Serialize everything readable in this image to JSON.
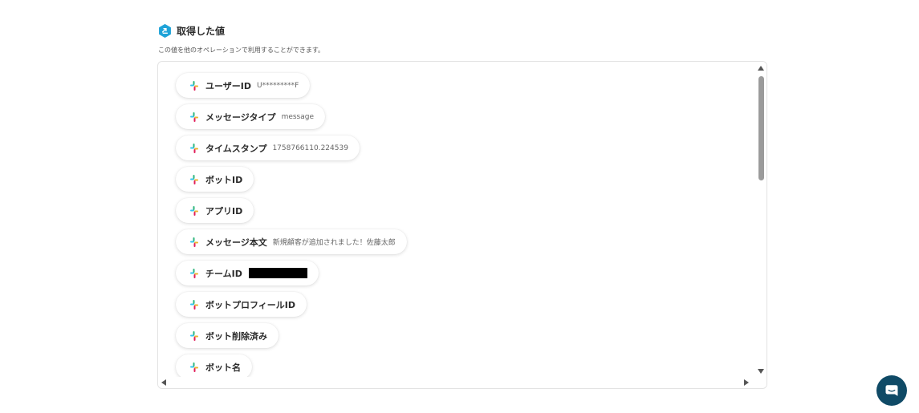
{
  "section": {
    "title": "取得した値",
    "description": "この値を他のオペレーションで利用することができます。"
  },
  "items": [
    {
      "label": "ユーザーID",
      "value": "U*********F"
    },
    {
      "label": "メッセージタイプ",
      "value": "message"
    },
    {
      "label": "タイムスタンプ",
      "value": "1758766110.224539"
    },
    {
      "label": "ボットID",
      "value": ""
    },
    {
      "label": "アプリID",
      "value": ""
    },
    {
      "label": "メッセージ本文",
      "value": "新規顧客が追加されました！佐藤太郎"
    },
    {
      "label": "チームID",
      "value": ""
    },
    {
      "label": "ボットプロフィールID",
      "value": ""
    },
    {
      "label": "ボット削除済み",
      "value": ""
    },
    {
      "label": "ボット名",
      "value": ""
    }
  ],
  "icons": {
    "section": "bolt-badge-icon",
    "item": "slack-icon",
    "chat": "chat-bubble-icon"
  },
  "colors": {
    "accent": "#1fa3d8",
    "chat_button": "#0f4a66"
  }
}
